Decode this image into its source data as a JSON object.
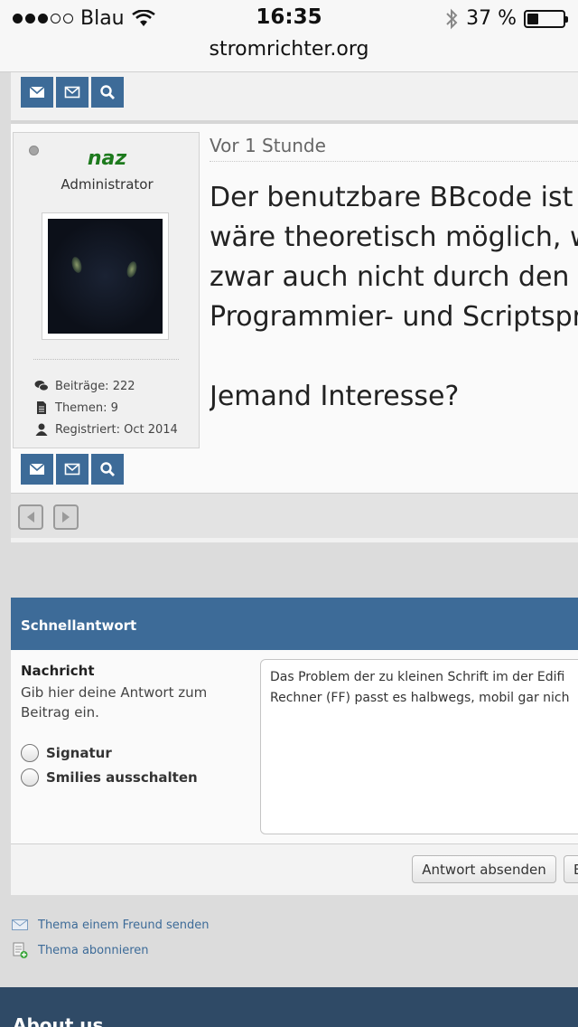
{
  "status_bar": {
    "carrier": "Blau",
    "time": "16:35",
    "battery_percent": "37 %",
    "battery_level": 0.37,
    "url": "stromrichter.org"
  },
  "post": {
    "author": {
      "name": "naz",
      "rank": "Administrator",
      "stats": [
        {
          "icon": "comments-icon",
          "label": "Beiträge: 222"
        },
        {
          "icon": "document-icon",
          "label": "Themen: 9"
        },
        {
          "icon": "user-icon",
          "label": "Registriert: Oct 2014"
        }
      ]
    },
    "date": "Vor 1 Stunde",
    "body_lines": [
      "Der benutzbare BBcode ist f",
      "wäre theoretisch möglich, w",
      "zwar auch nicht durch den U",
      "Programmier- und Scriptspr"
    ],
    "body_last": "Jemand Interesse?"
  },
  "quick_reply": {
    "title": "Schnellantwort",
    "message_label": "Nachricht",
    "message_hint": "Gib hier deine Antwort zum Beitrag ein.",
    "options": [
      "Signatur",
      "Smilies ausschalten"
    ],
    "textarea_lines": [
      "Das Problem der zu kleinen Schrift im der Edifi",
      "Rechner (FF) passt es halbwegs, mobil gar nich"
    ],
    "submit_label": "Antwort absenden",
    "second_button_label": "E"
  },
  "links": [
    {
      "icon": "envelope-icon",
      "label": "Thema einem Freund senden"
    },
    {
      "icon": "subscribe-icon",
      "label": "Thema abonnieren"
    }
  ],
  "footer": {
    "title": "About us"
  },
  "colors": {
    "accent": "#3d6b98",
    "username": "#1d7a1d",
    "footer": "#2f4a66"
  }
}
